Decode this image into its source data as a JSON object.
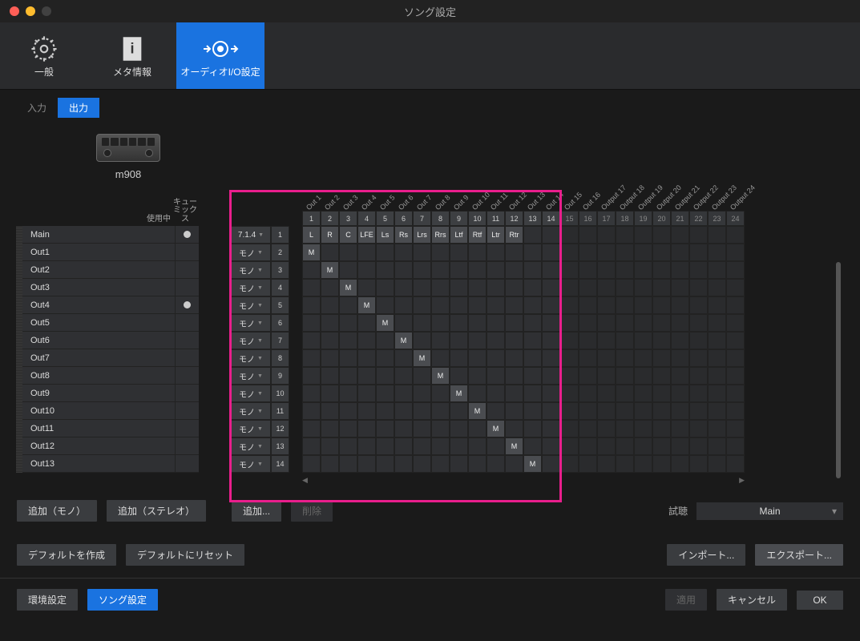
{
  "window": {
    "title": "ソング設定"
  },
  "top_tabs": {
    "general": "一般",
    "meta": "メタ情報",
    "audio_io": "オーディオI/O設定"
  },
  "io_tabs": {
    "input": "入力",
    "output": "出力"
  },
  "device": {
    "name": "m908"
  },
  "left": {
    "header_inuse": "使用中",
    "header_cue": "キューミックス",
    "channels": [
      {
        "name": "Main",
        "inuse": true
      },
      {
        "name": "Out1",
        "inuse": false
      },
      {
        "name": "Out2",
        "inuse": false
      },
      {
        "name": "Out3",
        "inuse": false
      },
      {
        "name": "Out4",
        "inuse": true
      },
      {
        "name": "Out5",
        "inuse": false
      },
      {
        "name": "Out6",
        "inuse": false
      },
      {
        "name": "Out7",
        "inuse": false
      },
      {
        "name": "Out8",
        "inuse": false
      },
      {
        "name": "Out9",
        "inuse": false
      },
      {
        "name": "Out10",
        "inuse": false
      },
      {
        "name": "Out11",
        "inuse": false
      },
      {
        "name": "Out12",
        "inuse": false
      },
      {
        "name": "Out13",
        "inuse": false
      }
    ]
  },
  "grid": {
    "cols_out": [
      "Out 1",
      "Out 2",
      "Out 3",
      "Out 4",
      "Out 5",
      "Out 6",
      "Out 7",
      "Out 8",
      "Out 9",
      "Out 10",
      "Out 11",
      "Out 12",
      "Out 13",
      "Out 14",
      "Out 15",
      "Out 16",
      "Output 17",
      "Output 18",
      "Output 19",
      "Output 20",
      "Output 21",
      "Output 22",
      "Output 23",
      "Output 24"
    ],
    "col_nums": [
      "1",
      "2",
      "3",
      "4",
      "5",
      "6",
      "7",
      "8",
      "9",
      "10",
      "11",
      "12",
      "13",
      "14",
      "15",
      "16",
      "17",
      "18",
      "19",
      "20",
      "21",
      "22",
      "23",
      "24"
    ],
    "rows": [
      {
        "format": "7.1.4",
        "num": "1",
        "cells": {
          "0": "L",
          "1": "R",
          "2": "C",
          "3": "LFE",
          "4": "Ls",
          "5": "Rs",
          "6": "Lrs",
          "7": "Rrs",
          "8": "Ltf",
          "9": "Rtf",
          "10": "Ltr",
          "11": "Rtr"
        }
      },
      {
        "format": "モノ",
        "num": "2",
        "cells": {
          "0": "M"
        }
      },
      {
        "format": "モノ",
        "num": "3",
        "cells": {
          "1": "M"
        }
      },
      {
        "format": "モノ",
        "num": "4",
        "cells": {
          "2": "M"
        }
      },
      {
        "format": "モノ",
        "num": "5",
        "cells": {
          "3": "M"
        }
      },
      {
        "format": "モノ",
        "num": "6",
        "cells": {
          "4": "M"
        }
      },
      {
        "format": "モノ",
        "num": "7",
        "cells": {
          "5": "M"
        }
      },
      {
        "format": "モノ",
        "num": "8",
        "cells": {
          "6": "M"
        }
      },
      {
        "format": "モノ",
        "num": "9",
        "cells": {
          "7": "M"
        }
      },
      {
        "format": "モノ",
        "num": "10",
        "cells": {
          "8": "M"
        }
      },
      {
        "format": "モノ",
        "num": "11",
        "cells": {
          "9": "M"
        }
      },
      {
        "format": "モノ",
        "num": "12",
        "cells": {
          "10": "M"
        }
      },
      {
        "format": "モノ",
        "num": "13",
        "cells": {
          "11": "M"
        }
      },
      {
        "format": "モノ",
        "num": "14",
        "cells": {
          "12": "M"
        }
      }
    ]
  },
  "buttons": {
    "add_mono": "追加（モノ）",
    "add_stereo": "追加（ステレオ）",
    "add_more": "追加...",
    "remove": "削除",
    "listen_label": "試聴",
    "listen_value": "Main",
    "create_default": "デフォルトを作成",
    "reset_default": "デフォルトにリセット",
    "import": "インポート...",
    "export": "エクスポート...",
    "preferences": "環境設定",
    "song_settings": "ソング設定",
    "apply": "適用",
    "cancel": "キャンセル",
    "ok": "OK"
  }
}
